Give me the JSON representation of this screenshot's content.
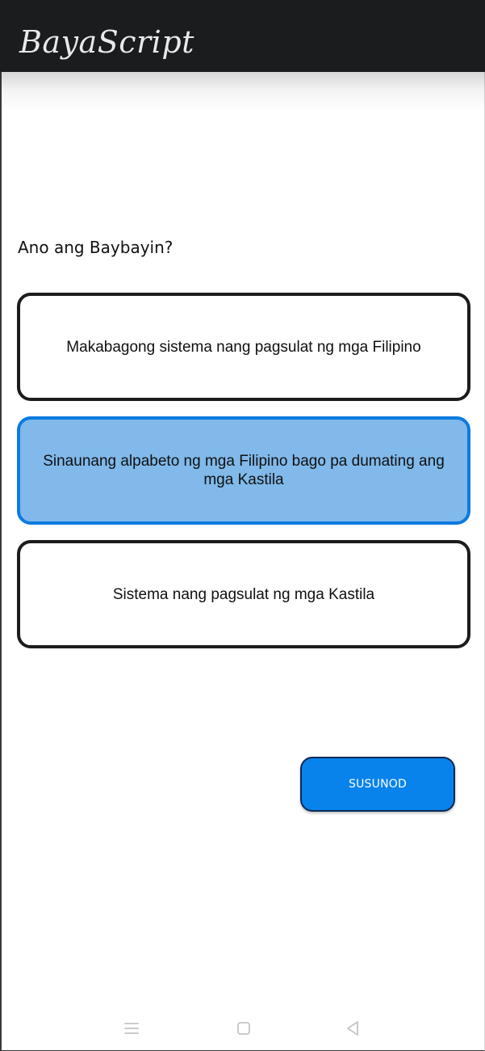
{
  "app": {
    "title": "BayaScript"
  },
  "quiz": {
    "question": "Ano ang Baybayin?",
    "options": [
      {
        "label": "Makabagong sistema nang pagsulat ng mga Filipino",
        "selected": false
      },
      {
        "label": "Sinaunang alpabeto ng mga Filipino bago pa dumating ang mga Kastila",
        "selected": true
      },
      {
        "label": "Sistema nang pagsulat ng mga Kastila",
        "selected": false
      }
    ],
    "next_button_label": "SUSUNOD"
  },
  "nav_bar": {
    "icons": [
      "menu-icon",
      "home-square-icon",
      "back-triangle-icon"
    ]
  },
  "colors": {
    "app_bar": "#1b1c1e",
    "selected_fill": "#80b9ea",
    "selected_border": "#0b7be0",
    "option_border": "#1c1c1c",
    "button": "#0883ec",
    "button_border": "#0a2a55",
    "nav_icon": "#c4c4c4"
  }
}
